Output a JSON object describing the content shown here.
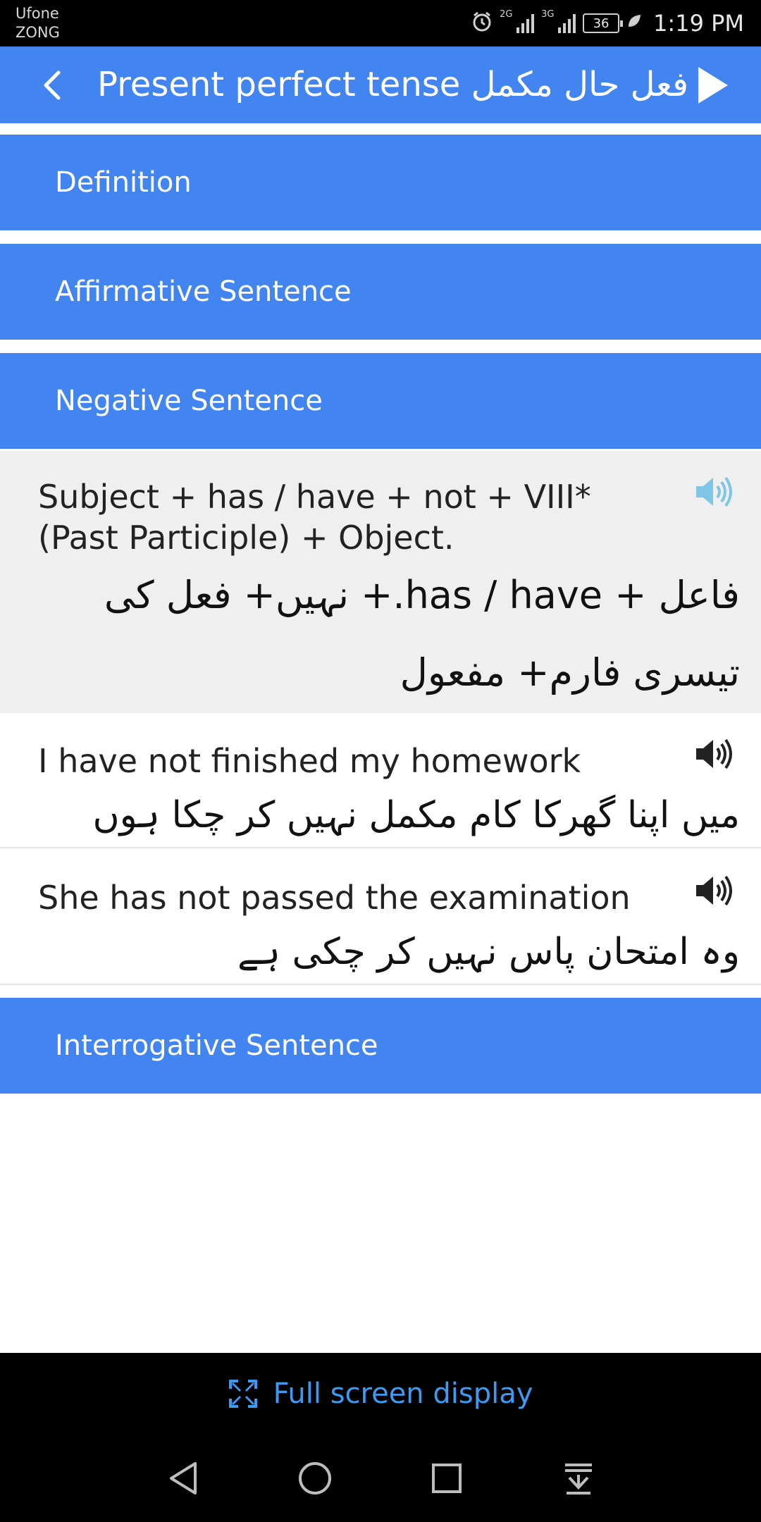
{
  "status_bar": {
    "carrier_line1": "Ufone",
    "carrier_line2": "ZONG",
    "signal1_label": "2G",
    "signal2_label": "3G",
    "battery": "36",
    "time": "1:19 PM"
  },
  "app_bar": {
    "title": "Present perfect tense  فعل حال مکمل"
  },
  "sections": {
    "definition": "Definition",
    "affirmative": "Affirmative Sentence",
    "negative": "Negative Sentence",
    "interrogative": "Interrogative Sentence"
  },
  "formula": {
    "english": "Subject + has / have + not + VIII* (Past Participle) + Object.",
    "urdu_line1": "فاعل  + has / have.+ نہیں+  فعل کی",
    "urdu_line2": "تیسری فارم+ مفعول"
  },
  "examples": [
    {
      "english": "I have not finished my homework",
      "urdu": "میں  اپنا گھرکا کام مکمل نہیں کر چکا ہوں"
    },
    {
      "english": "She has not passed the examination",
      "urdu": "وہ امتحان پاس نہیں کر چکی ہے"
    }
  ],
  "bottom": {
    "fullscreen_label": "Full screen display"
  },
  "colors": {
    "primary": "#4285f0",
    "formula_bg": "#efefef",
    "speaker_active": "#7fc6e6",
    "link": "#3d9af2"
  }
}
